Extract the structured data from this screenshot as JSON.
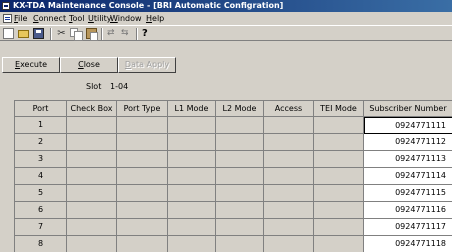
{
  "window": {
    "title": "KX-TDA Maintenance Console - [BRI Automatic Configration]"
  },
  "menu": [
    "File",
    "Connect",
    "Tool",
    "Utility",
    "Window",
    "Help"
  ],
  "toolbar": {
    "cut_glyph": "✂",
    "connect_glyph": "⇄",
    "disconnect_glyph": "⇆",
    "help_glyph": "?"
  },
  "actions": {
    "execute": "Execute",
    "close": "Close",
    "data_apply": "Data Apply"
  },
  "slot": {
    "label": "Slot",
    "value": "1-04"
  },
  "table": {
    "headers": [
      "Port",
      "Check Box",
      "Port Type",
      "L1 Mode",
      "L2 Mode",
      "Access",
      "TEI Mode",
      "Subscriber Number"
    ],
    "rows": [
      {
        "port": "1",
        "subscriber": "0924771111"
      },
      {
        "port": "2",
        "subscriber": "0924771112"
      },
      {
        "port": "3",
        "subscriber": "0924771113"
      },
      {
        "port": "4",
        "subscriber": "0924771114"
      },
      {
        "port": "5",
        "subscriber": "0924771115"
      },
      {
        "port": "6",
        "subscriber": "0924771116"
      },
      {
        "port": "7",
        "subscriber": "0924771117"
      },
      {
        "port": "8",
        "subscriber": "0924771118"
      }
    ]
  }
}
